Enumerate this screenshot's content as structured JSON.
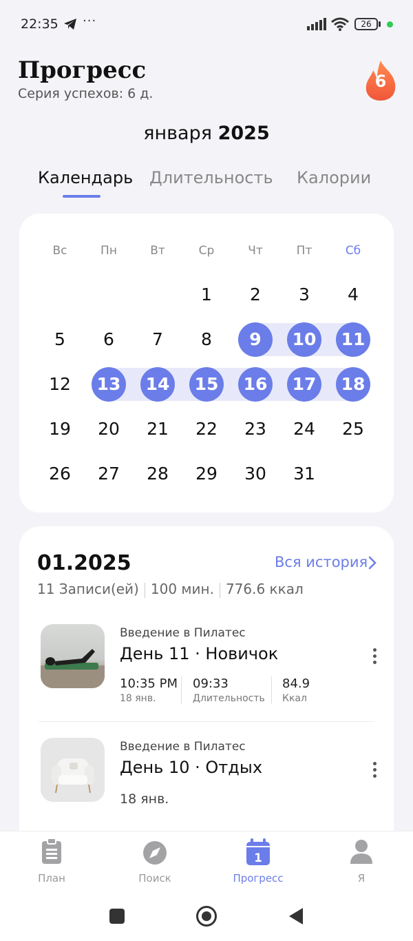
{
  "status": {
    "time": "22:35",
    "dots": "···",
    "battery": "26"
  },
  "header": {
    "title": "Прогресс",
    "streak": "Серия успехов: 6 д.",
    "streak_count": "6"
  },
  "month": {
    "name": "января",
    "year": "2025"
  },
  "tabs": [
    "Календарь",
    "Длительность",
    "Калории"
  ],
  "weekdays": [
    "Вс",
    "Пн",
    "Вт",
    "Ср",
    "Чт",
    "Пт",
    "Сб"
  ],
  "calendar": {
    "rows": [
      [
        "",
        "",
        "",
        "1",
        "2",
        "3",
        "4"
      ],
      [
        "5",
        "6",
        "7",
        "8",
        "9",
        "10",
        "11"
      ],
      [
        "12",
        "13",
        "14",
        "15",
        "16",
        "17",
        "18"
      ],
      [
        "19",
        "20",
        "21",
        "22",
        "23",
        "24",
        "25"
      ],
      [
        "26",
        "27",
        "28",
        "29",
        "30",
        "31",
        ""
      ]
    ],
    "completed_days": [
      "9",
      "10",
      "11",
      "13",
      "14",
      "15",
      "16",
      "17",
      "18"
    ]
  },
  "history": {
    "period": "01.2025",
    "all_link": "Вся история",
    "summary": [
      "11 Записи(ей)",
      "100 мин.",
      "776.6 ккал"
    ],
    "workouts": [
      {
        "program": "Введение в Пилатес",
        "title": "День 11 · Новичок",
        "stats": [
          {
            "value": "10:35 PM",
            "label": "18 янв."
          },
          {
            "value": "09:33",
            "label": "Длительность"
          },
          {
            "value": "84.9",
            "label": "Ккал"
          }
        ]
      },
      {
        "program": "Введение в Пилатес",
        "title": "День 10 · Отдых",
        "date": "18 янв."
      }
    ]
  },
  "nav": [
    {
      "label": "План",
      "icon": "clipboard-icon"
    },
    {
      "label": "Поиск",
      "icon": "compass-icon"
    },
    {
      "label": "Прогресс",
      "icon": "calendar-icon",
      "badge": "1",
      "active": true
    },
    {
      "label": "Я",
      "icon": "person-icon"
    }
  ],
  "colors": {
    "accent": "#6b7de8",
    "band": "#e7e9fb",
    "fire": "#f26a3a"
  }
}
